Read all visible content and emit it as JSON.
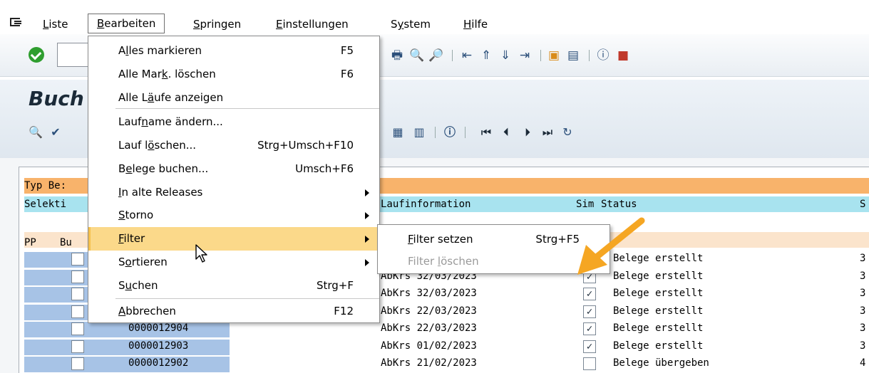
{
  "menubar": {
    "items": [
      {
        "label": "Liste",
        "mnemonic": 0
      },
      {
        "label": "Bearbeiten",
        "mnemonic": 0
      },
      {
        "label": "Springen",
        "mnemonic": 0
      },
      {
        "label": "Einstellungen",
        "mnemonic": 0
      },
      {
        "label": "System",
        "mnemonic": 1
      },
      {
        "label": "Hilfe",
        "mnemonic": 0
      }
    ]
  },
  "title": {
    "text": "Buch"
  },
  "list": {
    "header_row1": "Typ Be:",
    "header_row2_left": "Selekti",
    "header_row2_info": "Laufinformation",
    "header_row2_sim": "Sim",
    "header_row2_status": "Status",
    "header_row2_last": "S",
    "group_pp": "PP",
    "group_bu": "Bu",
    "rows": [
      {
        "num": "",
        "info": "",
        "sim": true,
        "status": "Belege erstellt",
        "last": "3"
      },
      {
        "num": "",
        "info": "AbKrs 32/03/2023",
        "sim": true,
        "status": "Belege erstellt",
        "last": "3"
      },
      {
        "num": "",
        "info": "AbKrs 32/03/2023",
        "sim": true,
        "status": "Belege erstellt",
        "last": "3"
      },
      {
        "num": "",
        "info": "AbKrs 22/03/2023",
        "sim": true,
        "status": "Belege erstellt",
        "last": "3"
      },
      {
        "num": "0000012904",
        "info": "AbKrs 22/03/2023",
        "sim": true,
        "status": "Belege erstellt",
        "last": "3"
      },
      {
        "num": "0000012903",
        "info": "AbKrs 01/02/2023",
        "sim": true,
        "status": "Belege erstellt",
        "last": "3"
      },
      {
        "num": "0000012902",
        "info": "AbKrs 21/02/2023",
        "sim": false,
        "status": "Belege übergeben",
        "last": "4"
      }
    ]
  },
  "dropdown": {
    "items": [
      {
        "label": "Alles markieren",
        "shortcut": "F5",
        "mn": 1
      },
      {
        "label": "Alle Mark. löschen",
        "shortcut": "F6",
        "mn": 8
      },
      {
        "label": "Alle Läufe anzeigen",
        "shortcut": "",
        "mn": 6
      },
      {
        "label": "Laufname ändern...",
        "shortcut": "",
        "mn": 4
      },
      {
        "label": "Lauf löschen...",
        "shortcut": "Strg+Umsch+F10",
        "mn": 6
      },
      {
        "label": "Belege buchen...",
        "shortcut": "Umsch+F6",
        "mn": 1
      },
      {
        "label": "In alte Releases",
        "shortcut": "",
        "mn": 0,
        "submenu": true
      },
      {
        "label": "Storno",
        "shortcut": "",
        "mn": 0,
        "submenu": true
      },
      {
        "label": "Filter",
        "shortcut": "",
        "mn": 0,
        "submenu": true,
        "highlighted": true
      },
      {
        "label": "Sortieren",
        "shortcut": "",
        "mn": 1,
        "submenu": true
      },
      {
        "label": "Suchen",
        "shortcut": "Strg+F",
        "mn": 1
      },
      {
        "label": "Abbrechen",
        "shortcut": "F12",
        "mn": 0
      }
    ]
  },
  "submenu": {
    "items": [
      {
        "label": "Filter setzen",
        "shortcut": "Strg+F5",
        "mn": 0,
        "enabled": true
      },
      {
        "label": "Filter löschen",
        "shortcut": "",
        "mn": 7,
        "enabled": false
      }
    ]
  },
  "colors": {
    "highlight": "#fbd98a",
    "annotation": "#f5a623"
  }
}
